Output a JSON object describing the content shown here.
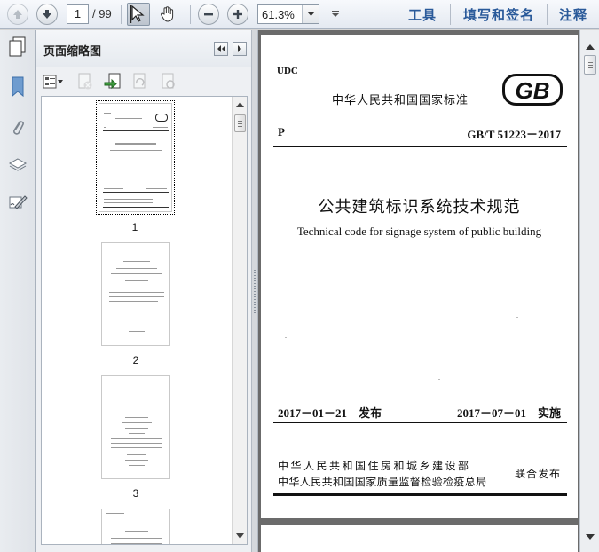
{
  "toolbar": {
    "page_current": "1",
    "page_total": "/ 99",
    "zoom": "61.3%",
    "links": [
      "工具",
      "填写和签名",
      "注释"
    ]
  },
  "panel": {
    "title": "页面缩略图",
    "thumbnails": [
      {
        "label": "1",
        "selected": true
      },
      {
        "label": "2",
        "selected": false
      },
      {
        "label": "3",
        "selected": false
      }
    ]
  },
  "document": {
    "udc": "UDC",
    "standard_type": "中华人民共和国国家标准",
    "logo_text": "GB",
    "category": "P",
    "standard_number": "GB/T 51223－2017",
    "title_cn": "公共建筑标识系统技术规范",
    "title_en": "Technical code for signage system of public building",
    "issue_date": "2017－01－21　发布",
    "implement_date": "2017－07－01　实施",
    "org1": "中华人民共和国住房和城乡建设部",
    "org2": "中华人民共和国国家质量监督检验检疫总局",
    "joint_issue": "联合发布"
  },
  "colors": {
    "accent_link": "#2a5a9a",
    "viewport_bg": "#6b6b6b"
  }
}
